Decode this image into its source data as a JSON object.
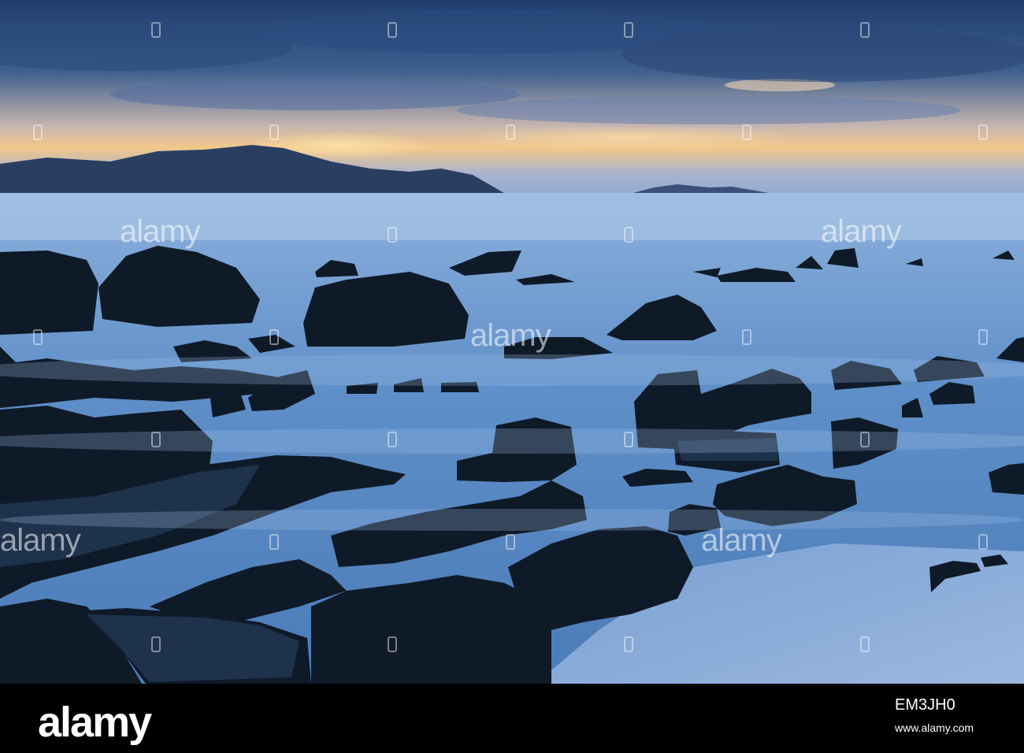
{
  "watermark": {
    "text": "alamy"
  },
  "footer": {
    "brand": "alamy",
    "image_code": "EM3JH0",
    "site": "www.alamy.com"
  },
  "colors": {
    "sky_top": "#2b4a78",
    "sky_glow": "#f2c88a",
    "sea": "#5f8fc8",
    "rock": "#0f1a28",
    "footer_bg": "#000000"
  }
}
